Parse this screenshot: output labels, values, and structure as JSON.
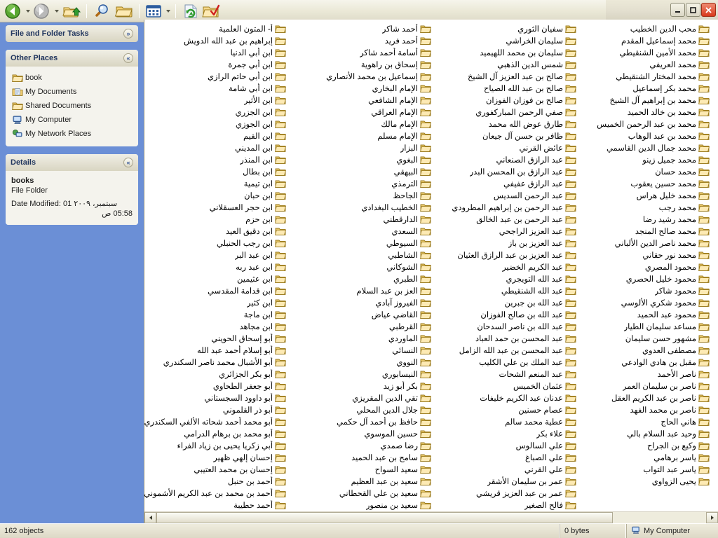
{
  "window": {
    "caption_buttons": [
      {
        "name": "minimize",
        "label": "–"
      },
      {
        "name": "maximize",
        "label": "□"
      },
      {
        "name": "close",
        "label": "✕"
      }
    ]
  },
  "toolbar": {
    "items": [
      {
        "name": "back-button",
        "icon": "back-arrow-icon",
        "label": "Back"
      },
      {
        "name": "back-dropdown",
        "icon": "chevron-down-icon",
        "label": ""
      },
      {
        "name": "forward-button",
        "icon": "forward-arrow-icon",
        "label": "Forward"
      },
      {
        "name": "forward-dropdown",
        "icon": "chevron-down-icon",
        "label": ""
      },
      {
        "name": "up-button",
        "icon": "up-folder-icon",
        "label": "Up"
      },
      {
        "name": "search-button",
        "icon": "search-icon",
        "label": "Search"
      },
      {
        "name": "folders-button",
        "icon": "folders-icon",
        "label": "Folders"
      },
      {
        "name": "views-button",
        "icon": "views-icon",
        "label": "Views"
      },
      {
        "name": "views-dropdown",
        "icon": "chevron-down-icon",
        "label": ""
      },
      {
        "name": "refresh-button",
        "icon": "refresh-icon",
        "label": "Refresh"
      },
      {
        "name": "edit-button",
        "icon": "folder-check-icon",
        "label": "Edit"
      }
    ]
  },
  "sidebar": {
    "file_tasks": {
      "title": "File and Folder Tasks",
      "collapse_glyph": "»"
    },
    "other_places": {
      "title": "Other Places",
      "collapse_glyph": "«",
      "items": [
        {
          "label": "book",
          "icon": "folder-icon"
        },
        {
          "label": "My Documents",
          "icon": "my-documents-icon"
        },
        {
          "label": "Shared Documents",
          "icon": "shared-documents-icon"
        },
        {
          "label": "My Computer",
          "icon": "my-computer-icon"
        },
        {
          "label": "My Network Places",
          "icon": "network-places-icon"
        }
      ]
    },
    "details": {
      "title": "Details",
      "collapse_glyph": "«",
      "name": "books",
      "type": "File Folder",
      "date_modified": "Date Modified: 01 سبتمبر، ٢٠٠٩",
      "date_modified_time": "05:58 ص"
    }
  },
  "statusbar": {
    "objects": "162 objects",
    "size": "0 bytes",
    "location": "My Computer",
    "location_icon": "my-computer-icon"
  },
  "filelist": {
    "columns": [
      [
        "أ- المتون العلمية",
        "إبراهيم بن عبد الله الدويش",
        "ابن أبي الدنيا",
        "ابن أبي جمرة",
        "ابن أبي حاتم الرازي",
        "ابن أبي شامة",
        "ابن الأثير",
        "ابن الجزري",
        "ابن الجوزي",
        "ابن القيم",
        "ابن المديني",
        "ابن المنذر",
        "ابن بطال",
        "ابن تيمية",
        "ابن حبان",
        "ابن حجر العسقلاني",
        "ابن حزم",
        "ابن دقيق العيد",
        "ابن رجب الحنبلي",
        "ابن عبد البر",
        "ابن عبد ربه",
        "ابن عثيمين",
        "ابن قدامة المقدسي",
        "ابن كثير",
        "ابن ماجة",
        "ابن مجاهد",
        "أبو إسحاق الحويني",
        "أبو إسلام أحمد عبد الله",
        "أبو الأشبال محمد ناصر السكندري",
        "أبو بكر الجزائري",
        "أبو جعفر الطحاوي",
        "أبو داوود السجستاني",
        "أبو ذر القلموني",
        "أبو محمد أحمد شحاته الألفي السكندري",
        "أبو محمد بن برهام الدرامي",
        "أبي زكريا يحيى بن زياد الفراء",
        "إحسان إلهي ظهير",
        "إحسان بن محمد العتيبي",
        "أحمد بن حنبل",
        "أحمد بن محمد بن عبد الكريم الأشموني",
        "أحمد حطيبة"
      ],
      [
        "أحمد شاكر",
        "أحمد فريد",
        "أسامة أحمد شاكر",
        "إسحاق بن راهوية",
        "إسماعيل بن محمد الأنصاري",
        "الإمام البخاري",
        "الإمام الشافعي",
        "الإمام العراقي",
        "الإمام مالك",
        "الإمام مسلم",
        "البزار",
        "البغوي",
        "البيهقي",
        "الترمذي",
        "الجاحظ",
        "الخطيب البغدادي",
        "الدارقطني",
        "السعدي",
        "السيوطي",
        "الشاطبي",
        "الشوكاني",
        "الطبري",
        "العز بن عبد السلام",
        "الفيروز آبادي",
        "القاضي عياض",
        "القرطبي",
        "الماوردي",
        "النسائي",
        "النووي",
        "النيسابوري",
        "بكر أبو زيد",
        "تقي الدين المقريزي",
        "جلال الدين المحلي",
        "حافظ بن أحمد آل حكمي",
        "حسين الموسوي",
        "رضا صمدي",
        "سامح بن عبد الحميد",
        "سعيد السواح",
        "سعيد بن عبد العظيم",
        "سعيد بن علي القحطاني",
        "سعيد بن منصور"
      ],
      [
        "سفيان الثوري",
        "سليمان الخراشي",
        "سليمان بن محمد اللهيميد",
        "شمس الدين الذهبي",
        "صالح بن عبد العزيز آل الشيخ",
        "صالح بن عبد الله الصياح",
        "صالح بن فوزان الفوزان",
        "صفي الرحمن المباركفوري",
        "طارق عوض الله محمد",
        "ظافر بن حسن آل جيعان",
        "عائض القرني",
        "عبد الرازق الصنعاني",
        "عبد الرازق بن المحسن البدر",
        "عبد الرازق عفيفي",
        "عبد الرحمن السديس",
        "عبد الرحمن بن إبراهيم المطرودي",
        "عبد الرحمن بن عبد الخالق",
        "عبد العزيز الراجحي",
        "عبد العزيز بن باز",
        "عبد العزيز بن عبد الرازق العثيان",
        "عبد الكريم الخضير",
        "عبد الله التويجري",
        "عبد الله الشنقيطي",
        "عبد الله بن جبرين",
        "عبد الله بن صالح الفوزان",
        "عبد الله بن ناصر السدحان",
        "عبد المحسن بن حمد العباد",
        "عبد المحسن بن عبد الله الزامل",
        "عبد الملك بن علي الكليب",
        "عبد المنعم الشحات",
        "عثمان الخميس",
        "عدنان عبد الكريم خليفات",
        "عصام حسنين",
        "عطية محمد سالم",
        "علاء بكر",
        "علي السالوس",
        "علي الصباغ",
        "علي القرني",
        "عمر بن سليمان الأشقر",
        "عمر بن عبد العزيز قريشي",
        "فالح الصغير"
      ],
      [
        "محب الدين الخطيب",
        "محمد إسماعيل المقدم",
        "محمد الأمين الشنقيطي",
        "محمد العريفي",
        "محمد المختار الشنقيطي",
        "محمد بكر إسماعيل",
        "محمد بن إبراهيم آل الشيخ",
        "محمد بن خالد الحميد",
        "محمد بن عبد الرحمن الخميس",
        "محمد بن عبد الوهاب",
        "محمد جمال الدين القاسمي",
        "محمد جميل زينو",
        "محمد حسان",
        "محمد حسين يعقوب",
        "محمد خليل هراس",
        "محمد رجب",
        "محمد رشيد رضا",
        "محمد صالح المنجد",
        "محمد ناصر الدين الألباني",
        "محمد نور حقاني",
        "محمود المصري",
        "محمود خليل الحصري",
        "محمود شاكر",
        "محمود شكري الألوسي",
        "محمود عبد الحميد",
        "مساعد سليمان الطيار",
        "مشهور حسن سليمان",
        "مصطفى العدوي",
        "مقبل بن هادي الوادعي",
        "ناصر الأحمد",
        "ناصر بن سليمان العمر",
        "ناصر بن عبد الكريم العقل",
        "ناصر بن محمد الفهد",
        "هاني الحاج",
        "وحيد عبد السلام بالي",
        "وكيع بن الجراح",
        "ياسر برهامي",
        "ياسر عبد التواب",
        "يحيى الزواوي"
      ]
    ]
  }
}
